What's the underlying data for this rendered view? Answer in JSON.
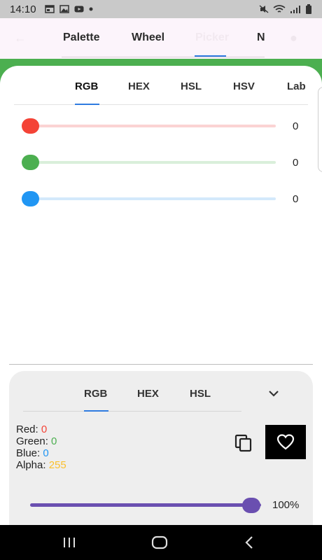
{
  "status_bar": {
    "time": "14:10",
    "left_icons": [
      "calendar-icon",
      "image-icon",
      "youtube-icon",
      "dot-icon"
    ],
    "right_icons": [
      "mute-icon",
      "wifi-icon",
      "signal-icon",
      "battery-icon"
    ]
  },
  "top_tabs": {
    "items": [
      {
        "label": "Palette"
      },
      {
        "label": "Wheel"
      },
      {
        "label": "Picker"
      },
      {
        "label": "N"
      }
    ],
    "selected_index": 2
  },
  "model_tabs": {
    "items": [
      {
        "label": "RGB"
      },
      {
        "label": "HEX"
      },
      {
        "label": "HSL"
      },
      {
        "label": "HSV"
      },
      {
        "label": "Lab"
      }
    ],
    "selected": "RGB"
  },
  "sliders": [
    {
      "channel": "red",
      "value": "0",
      "color": "#f44336",
      "track": "#fbd3d3"
    },
    {
      "channel": "green",
      "value": "0",
      "color": "#4caf50",
      "track": "#d9efda"
    },
    {
      "channel": "blue",
      "value": "0",
      "color": "#2196f3",
      "track": "#d3e9fb"
    }
  ],
  "panel": {
    "tabs": [
      {
        "label": "RGB"
      },
      {
        "label": "HEX"
      },
      {
        "label": "HSL"
      }
    ],
    "selected": "RGB",
    "values": {
      "red_label": "Red:",
      "red_value": "0",
      "green_label": "Green:",
      "green_value": "0",
      "blue_label": "Blue:",
      "blue_value": "0",
      "alpha_label": "Alpha:",
      "alpha_value": "255"
    },
    "alpha_percent": "100%",
    "alpha_fraction": 1.0
  },
  "colors": {
    "accent_blue": "#2f7be0",
    "green_band": "#4caf50",
    "alpha_slider": "#6a4fb0"
  },
  "nav_bar": {
    "buttons": [
      "recents-icon",
      "home-icon",
      "back-icon"
    ]
  }
}
